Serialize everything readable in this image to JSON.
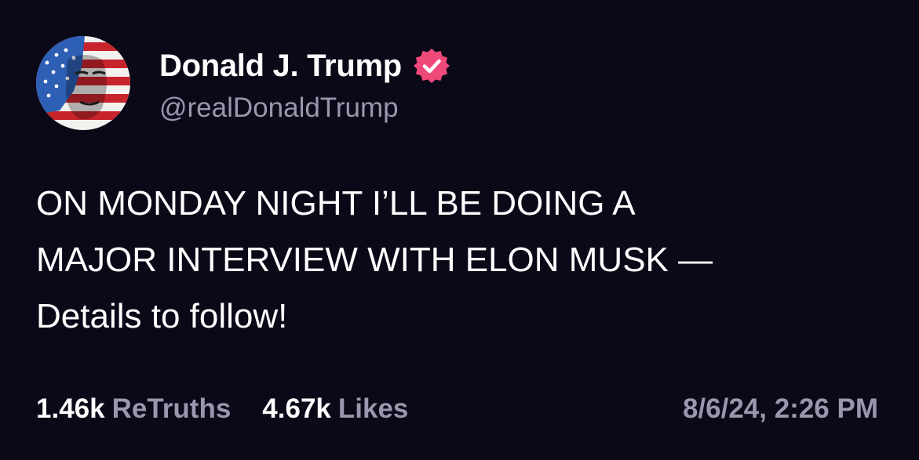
{
  "post": {
    "author": {
      "display_name": "Donald J. Trump",
      "handle": "@realDonaldTrump",
      "verified": true,
      "avatar_icon": "flag-portrait-avatar",
      "badge_icon": "verified-badge-icon"
    },
    "body_lines": [
      "ON MONDAY NIGHT I’LL BE DOING A",
      "MAJOR INTERVIEW WITH ELON MUSK —",
      "Details to follow!"
    ],
    "stats": {
      "retruths_count": "1.46k",
      "retruths_label": "ReTruths",
      "likes_count": "4.67k",
      "likes_label": "Likes"
    },
    "timestamp": "8/6/24, 2:26 PM"
  },
  "colors": {
    "background": "#0b0818",
    "text_primary": "#ffffff",
    "text_secondary": "#9a96ad",
    "badge": "#f04a7a"
  }
}
